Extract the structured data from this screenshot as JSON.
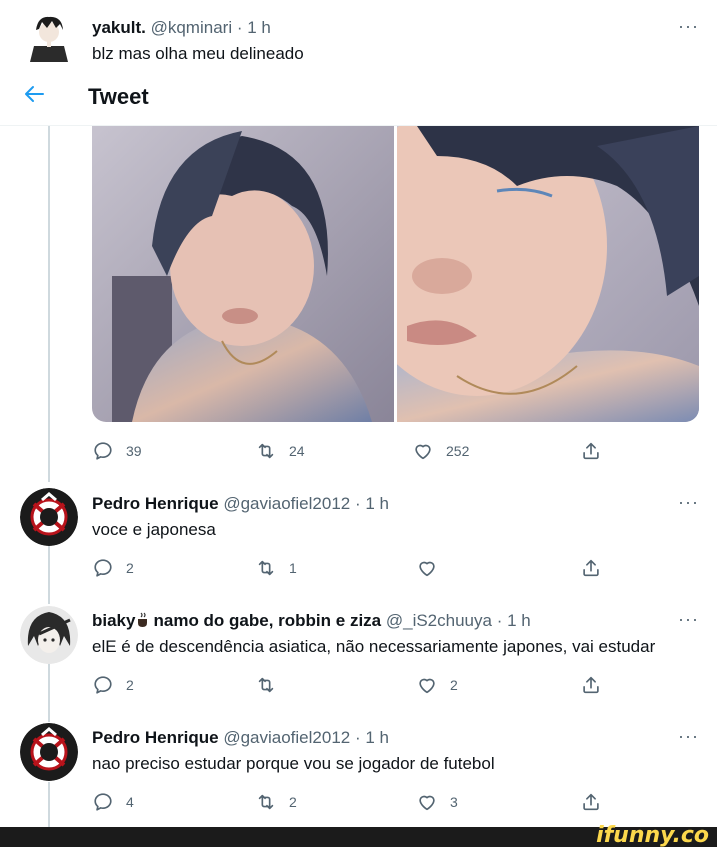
{
  "top_tweet": {
    "name": "yakult.",
    "handle": "@kqminari",
    "time": "1 h",
    "text": "blz mas olha meu delineado"
  },
  "header": {
    "title": "Tweet"
  },
  "main_actions": {
    "replies": "39",
    "retweets": "24",
    "likes": "252"
  },
  "replies": [
    {
      "name": "Pedro Henrique",
      "handle": "@gaviaofiel2012",
      "time": "1 h",
      "text": "voce e japonesa",
      "replies": "2",
      "retweets": "1",
      "likes": ""
    },
    {
      "name": "biaky",
      "name_suffix": "namo do gabe, robbin e ziza",
      "handle": "@_iS2chuuya",
      "time": "1 h",
      "text": "elE é de descendência asiatica, não necessariamente japones, vai estudar",
      "replies": "2",
      "retweets": "",
      "likes": "2"
    },
    {
      "name": "Pedro Henrique",
      "handle": "@gaviaofiel2012",
      "time": "1 h",
      "text": "nao preciso estudar porque vou se jogador de futebol",
      "replies": "4",
      "retweets": "2",
      "likes": "3"
    }
  ],
  "more_label": "···",
  "separator": "·",
  "footer": {
    "brand": "ifunny.co"
  },
  "colors": {
    "accent": "#1d9bf0",
    "muted": "#536471",
    "text": "#0f1419",
    "brand": "#fcd84c"
  }
}
